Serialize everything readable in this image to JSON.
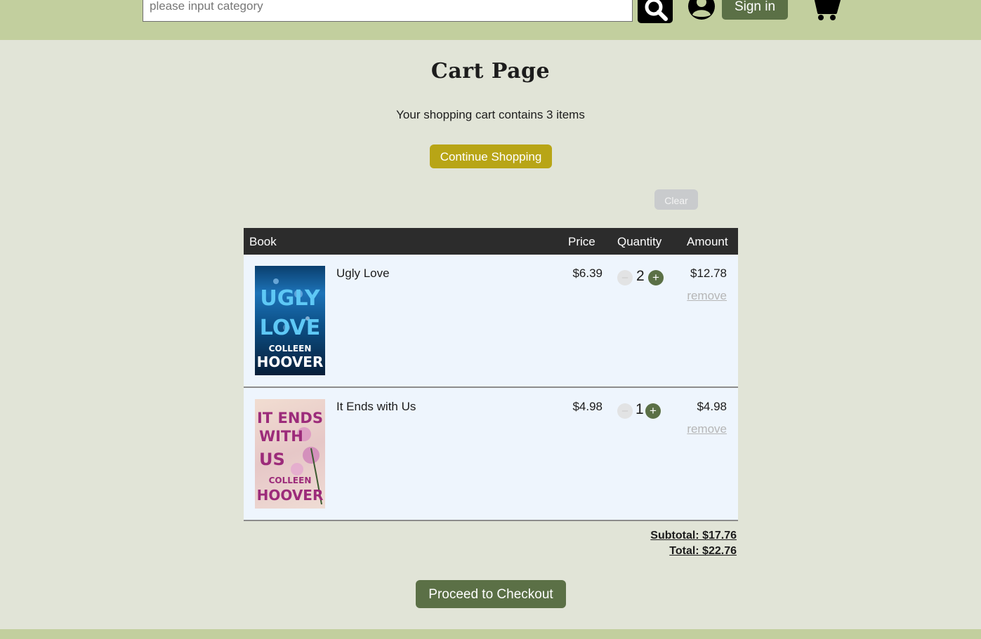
{
  "header": {
    "search_placeholder": "please input category",
    "signin_label": "Sign in"
  },
  "page": {
    "title": "Cart Page",
    "cart_summary": "Your shopping cart contains 3 items",
    "continue_label": "Continue Shopping",
    "clear_label": "Clear"
  },
  "table": {
    "headers": {
      "book": "Book",
      "price": "Price",
      "quantity": "Quantity",
      "amount": "Amount"
    },
    "rows": [
      {
        "title": "Ugly Love",
        "price": "$6.39",
        "quantity": "2",
        "amount": "$12.78",
        "remove_label": "remove",
        "cover": {
          "line1": "UGLY",
          "line2": "LOVE",
          "author1": "COLLEEN",
          "author2": "HOOVER"
        }
      },
      {
        "title": "It Ends with Us",
        "price": "$4.98",
        "quantity": "1",
        "amount": "$4.98",
        "remove_label": "remove",
        "cover": {
          "line1": "IT ENDS",
          "line2": "WITH",
          "line3": "US",
          "author1": "COLLEEN",
          "author2": "HOOVER"
        }
      }
    ]
  },
  "totals": {
    "subtotal": "Subtotal: $17.76",
    "total": "Total: $22.76"
  },
  "checkout_label": "Proceed to Checkout",
  "qty_controls": {
    "minus": "–",
    "plus": "+"
  },
  "colors": {
    "header_bg": "#c2cf9e",
    "page_bg": "#e1e4d7",
    "primary_button": "#5b7046",
    "continue_button": "#b8a516",
    "table_header": "#2c2c2c",
    "row_bg": "#eef5fd"
  },
  "icons": {
    "search": "search-icon",
    "user": "user-icon",
    "cart": "cart-icon"
  }
}
